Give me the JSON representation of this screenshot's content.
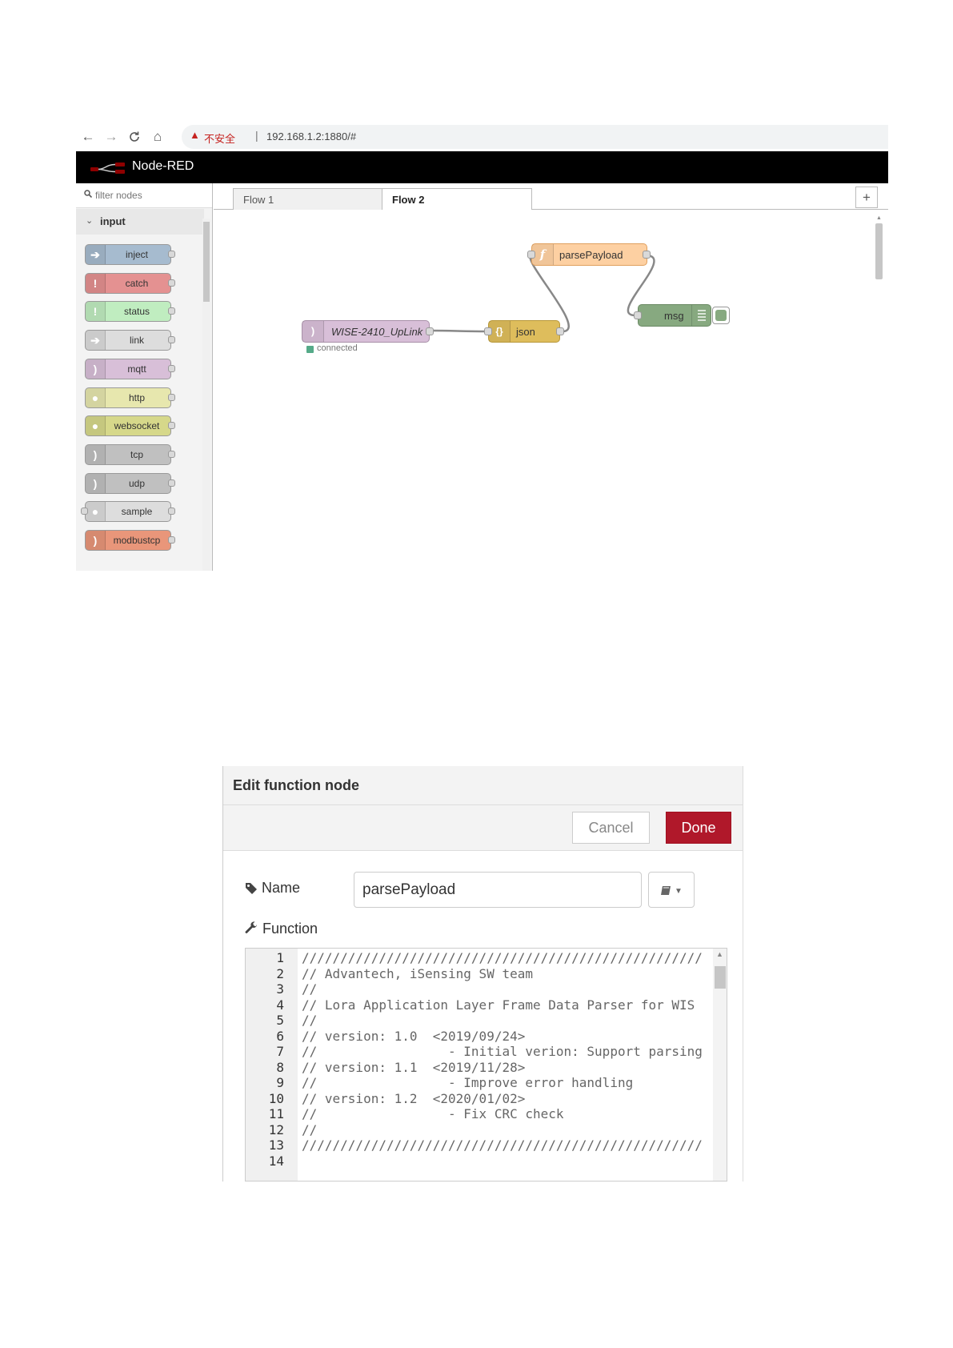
{
  "browser": {
    "back_icon": "←",
    "forward_icon": "→",
    "reload_icon": "C",
    "home_icon": "⌂",
    "warning_icon": "▲",
    "insecure_label": "不安全",
    "separator": "|",
    "url": "192.168.1.2:1880/#"
  },
  "nodered": {
    "title": "Node-RED",
    "palette": {
      "filter_placeholder": "filter nodes",
      "category": "input",
      "nodes": [
        {
          "label": "inject",
          "color": "#a6bbcf",
          "icon": "➔",
          "in_port": false
        },
        {
          "label": "catch",
          "color": "#e49191",
          "icon": "!",
          "in_port": false
        },
        {
          "label": "status",
          "color": "#c0edc0",
          "icon": "!",
          "in_port": false
        },
        {
          "label": "link",
          "color": "#dddddd",
          "icon": "➔",
          "in_port": false
        },
        {
          "label": "mqtt",
          "color": "#d8bfd8",
          "icon": ")",
          "in_port": false
        },
        {
          "label": "http",
          "color": "#e7e7ae",
          "icon": "●",
          "in_port": false
        },
        {
          "label": "websocket",
          "color": "#d6d88a",
          "icon": "●",
          "in_port": false
        },
        {
          "label": "tcp",
          "color": "#c0c0c0",
          "icon": ")",
          "in_port": false
        },
        {
          "label": "udp",
          "color": "#c0c0c0",
          "icon": ")",
          "in_port": false
        },
        {
          "label": "sample",
          "color": "#dddddd",
          "icon": "●",
          "in_port": true
        },
        {
          "label": "modbustcp",
          "color": "#e9967a",
          "icon": ")",
          "in_port": false
        }
      ]
    },
    "tabs": [
      {
        "label": "Flow 1",
        "active": false
      },
      {
        "label": "Flow 2",
        "active": true
      }
    ],
    "add_tab": "+",
    "flow": {
      "uplink": {
        "label": "WISE-2410_UpLink",
        "status": "connected",
        "color": "#d8bfd8",
        "status_color": "#5a8"
      },
      "json": {
        "label": "json",
        "color": "#debd5c"
      },
      "parse": {
        "label": "parsePayload",
        "color": "#fdd0a2",
        "icon": "f"
      },
      "debug": {
        "label": "msg",
        "color": "#87a980"
      }
    }
  },
  "dialog": {
    "title": "Edit function node",
    "cancel_label": "Cancel",
    "done_label": "Done",
    "name_label": "Name",
    "name_value": "parsePayload",
    "function_label": "Function",
    "tag_icon": "tag-icon",
    "wrench_icon": "wrench-icon",
    "code_lines": [
      "////////////////////////////////////////////////////",
      "// Advantech, iSensing SW team",
      "//",
      "// Lora Application Layer Frame Data Parser for WIS",
      "//",
      "// version: 1.0  <2019/09/24>",
      "//                 - Initial verion: Support parsing",
      "// version: 1.1  <2019/11/28>",
      "//                 - Improve error handling",
      "// version: 1.2  <2020/01/02>",
      "//                 - Fix CRC check",
      "//",
      "////////////////////////////////////////////////////",
      ""
    ],
    "line_numbers": [
      "1",
      "2",
      "3",
      "4",
      "5",
      "6",
      "7",
      "8",
      "9",
      "10",
      "11",
      "12",
      "13",
      "14"
    ]
  }
}
